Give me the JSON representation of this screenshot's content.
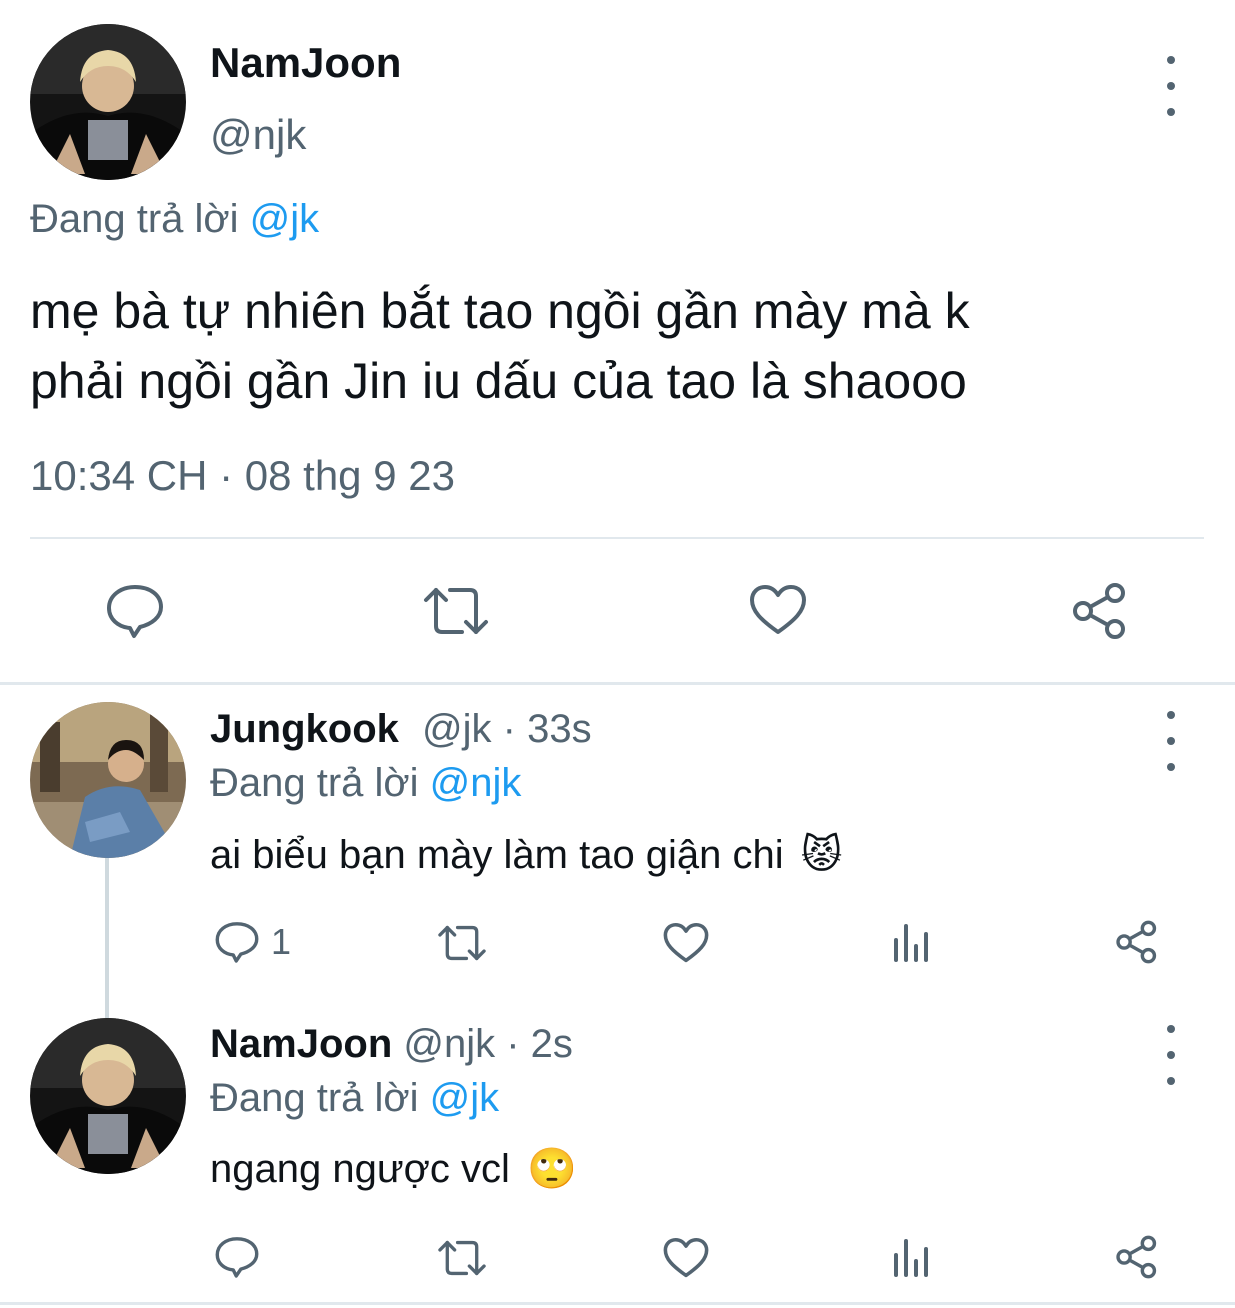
{
  "main_tweet": {
    "display_name": "NamJoon",
    "handle": "@njk",
    "reply_prefix": "Đang trả lời",
    "reply_to": "@jk",
    "text_line1": "mẹ bà tự nhiên bắt tao ngồi gần mày mà k",
    "text_line2": "phải ngồi gần Jin iu dấu của tao là shaooo",
    "timestamp": "10:34 CH · 08 thg 9 23"
  },
  "reply1": {
    "display_name": "Jungkook",
    "handle": "@jk",
    "time": "· 33s",
    "reply_prefix": "Đang trả lời",
    "reply_to": "@njk",
    "text": "ai biểu bạn mày làm tao giận chi",
    "emoji": "😾",
    "reply_count": "1"
  },
  "reply2": {
    "display_name": "NamJoon",
    "handle": "@njk",
    "time": "· 2s",
    "reply_prefix": "Đang trả lời",
    "reply_to": "@jk",
    "text": "ngang ngược vcl",
    "emoji": "🙄"
  },
  "colors": {
    "text": "#0f1419",
    "muted": "#536471",
    "link": "#1d9bf0",
    "divider": "#e1e8ed"
  }
}
